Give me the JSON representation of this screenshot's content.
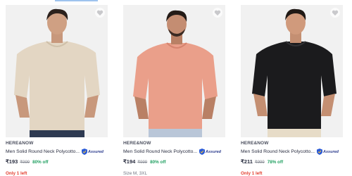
{
  "colors": {
    "discount": "#22a062",
    "only_left": "#e23e2f",
    "assured": "#2a3a8c",
    "card_bg": "#f1f1f1"
  },
  "products": [
    {
      "brand": "HERE&NOW",
      "title": "Men Solid Round Neck Polycotto...",
      "assured_label": "Assured",
      "price": "₹193",
      "mrp": "₹999",
      "discount": "80% off",
      "extra": "Only 1 left",
      "extra_type": "stock",
      "tshirt_color": "#e3d6c3"
    },
    {
      "brand": "HERE&NOW",
      "title": "Men Solid Round Neck Polycotto...",
      "assured_label": "Assured",
      "price": "₹194",
      "mrp": "₹999",
      "discount": "80% off",
      "extra": "Size M, 3XL",
      "extra_type": "size",
      "tshirt_color": "#ea9f8a"
    },
    {
      "brand": "HERE&NOW",
      "title": "Men Solid Round Neck Polycotto...",
      "assured_label": "Assured",
      "price": "₹211",
      "mrp": "₹999",
      "discount": "78% off",
      "extra": "Only 1 left",
      "extra_type": "stock",
      "tshirt_color": "#1b1b1d"
    }
  ]
}
